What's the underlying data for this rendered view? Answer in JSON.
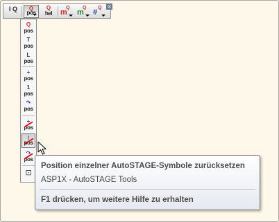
{
  "toolbar": {
    "buttons": [
      {
        "icon": "position-table-icon",
        "top": "I Q",
        "bottom": ""
      },
      {
        "icon": "pos-dropdown-icon",
        "top": "Q",
        "bottom": "pos"
      },
      {
        "icon": "pos-hl-icon",
        "top": "Q",
        "bottom": "hel"
      },
      {
        "icon": "m-q-red-icon",
        "top": "Q",
        "bottom": "m"
      },
      {
        "icon": "m-q-green-icon",
        "top": "Q",
        "bottom": "m"
      },
      {
        "icon": "hash-q-icon",
        "top": "Q",
        "bottom": "#"
      }
    ],
    "close_glyph": "×"
  },
  "palette": {
    "items": [
      {
        "top": "Q",
        "bottom": "pos"
      },
      {
        "top": "T",
        "bottom": "pos"
      },
      {
        "top": "L",
        "bottom": "pos"
      },
      {
        "top": "+",
        "bottom": "pos"
      },
      {
        "top": "1",
        "bottom": "pos"
      },
      {
        "top": "↷",
        "bottom": "pos"
      },
      {
        "top": "+",
        "bottom": "pos"
      },
      {
        "top": "/",
        "bottom": "pos"
      },
      {
        "top": "↷",
        "bottom": "pos"
      },
      {
        "top": "⊡",
        "bottom": ""
      }
    ]
  },
  "tooltip": {
    "title": "Position einzelner AutoSTAGE-Symbole zurücksetzen",
    "subtitle": "ASP1X - AutoSTAGE Tools",
    "help": "F1 drücken, um weitere Hilfe zu erhalten"
  },
  "colors": {
    "background": "#fdf8ea",
    "q_red": "#c03030",
    "q_green": "#1f8a2a",
    "q_blue": "#2a3fb0",
    "strike_red": "#dd1111"
  }
}
